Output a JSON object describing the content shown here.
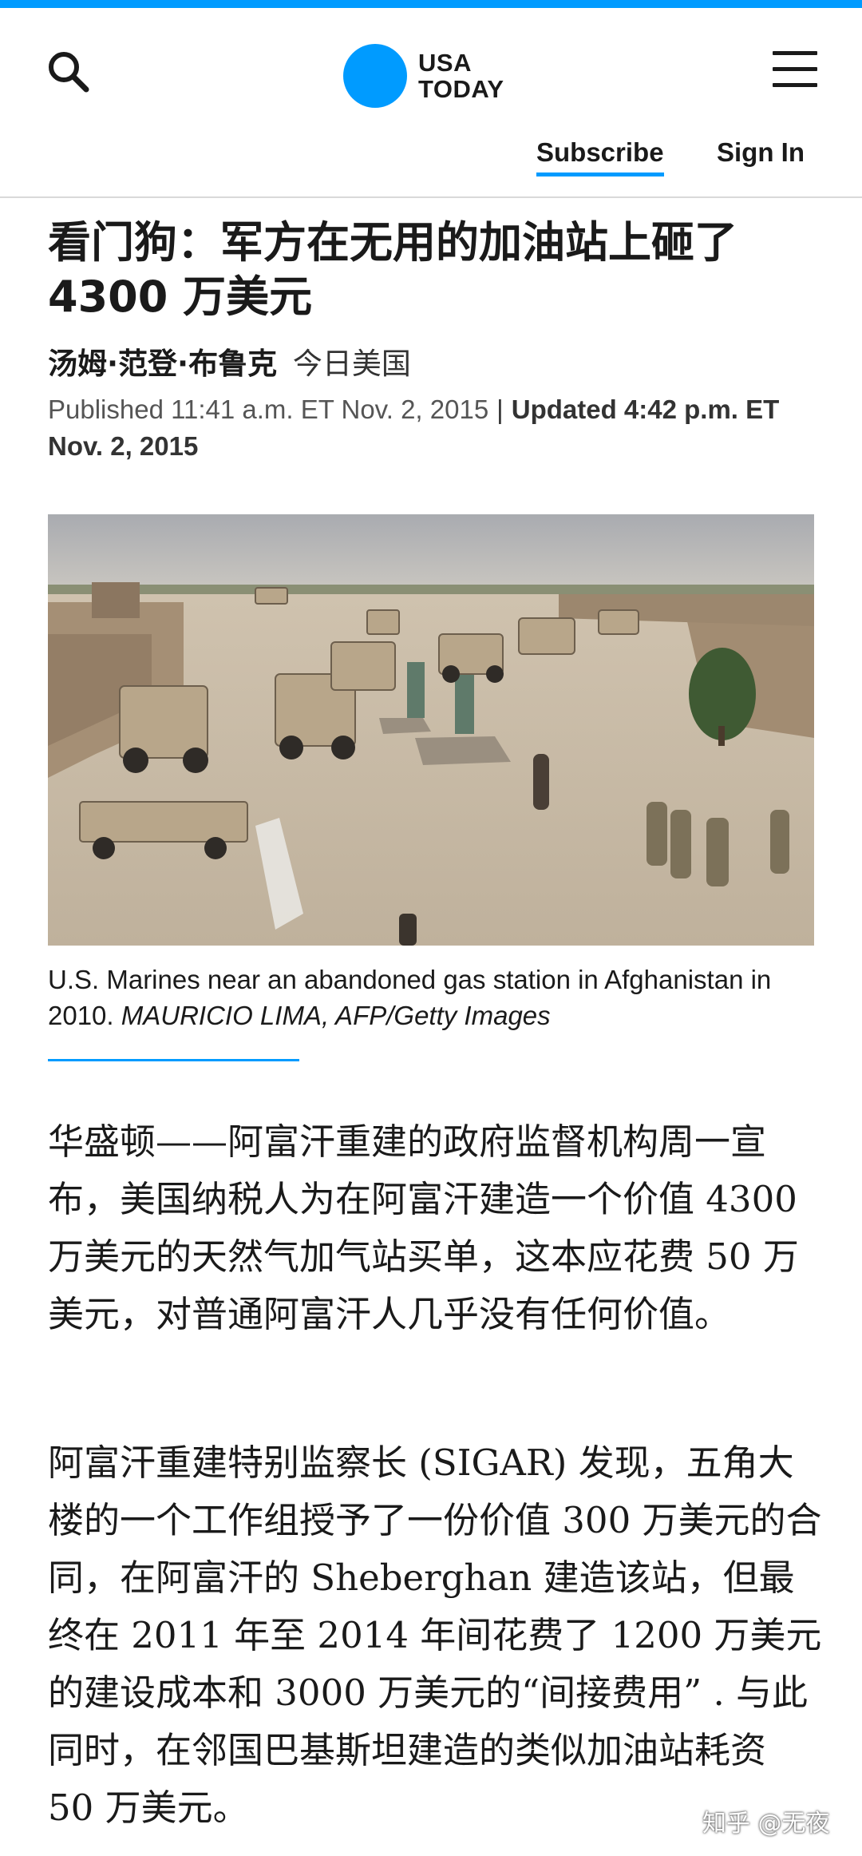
{
  "header": {
    "logo_line1": "USA",
    "logo_line2": "TODAY",
    "subscribe_label": "Subscribe",
    "signin_label": "Sign In",
    "icons": [
      "search-icon",
      "hamburger-menu-icon"
    ],
    "accent_color": "#009bff"
  },
  "article": {
    "headline": "看门狗：军方在无用的加油站上砸了 4300 万美元",
    "author": "汤姆·范登·布鲁克",
    "outlet": "今日美国",
    "published": "Published 11:41 a.m. ET Nov. 2, 2015",
    "separator": "|",
    "updated": "Updated 4:42 p.m. ET Nov. 2, 2015",
    "caption_text": "U.S. Marines near an abandoned gas station in Afghanistan in 2010. ",
    "caption_credit": "MAURICIO LIMA, AFP/Getty Images",
    "paragraphs": [
      "华盛顿——阿富汗重建的政府监督机构周一宣布，美国纳税人为在阿富汗建造一个价值 4300 万美元的天然气加气站买单，这本应花费 50 万美元，对普通阿富汗人几乎没有任何价值。",
      "阿富汗重建特别监察长 (SIGAR) 发现，五角大楼的一个工作组授予了一份价值 300 万美元的合同，在阿富汗的 Sheberghan 建造该站，但最终在 2011 年至 2014 年间花费了 1200 万美元的建设成本和 3000 万美元的“间接费用” . 与此同时，在邻国巴基斯坦建造的类似加油站耗资 50 万美元。"
    ]
  },
  "watermark": "知乎 @无夜"
}
